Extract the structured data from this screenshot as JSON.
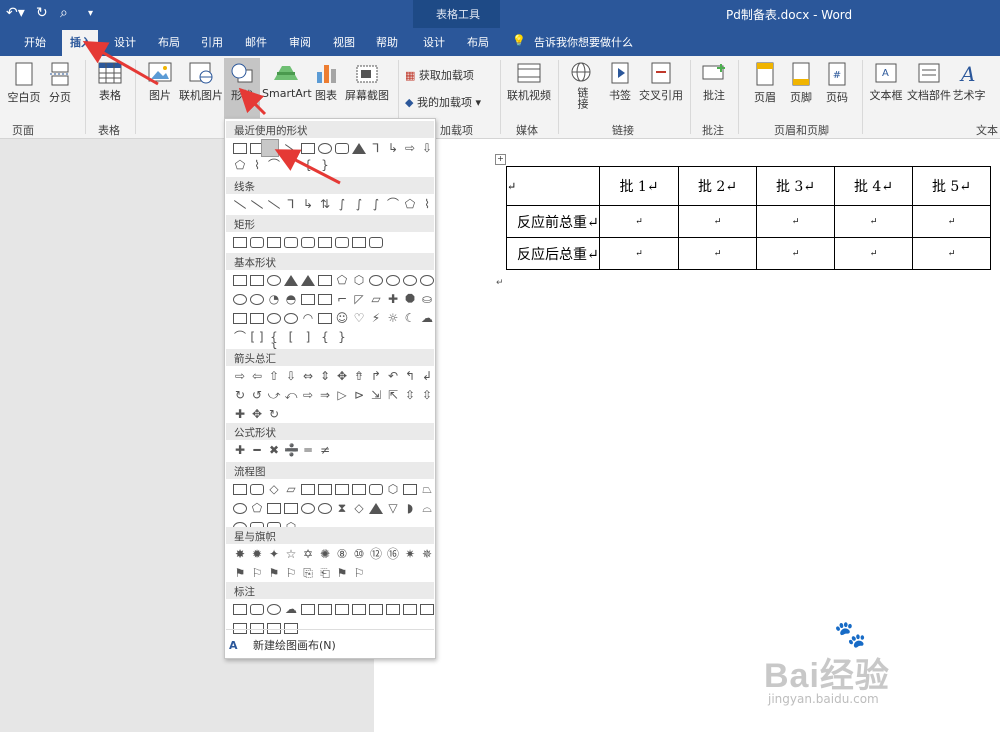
{
  "window": {
    "title": "Pd制备表.docx  -  Word",
    "context_group": "表格工具"
  },
  "quick_access": {
    "undo_icon": "undo-icon",
    "redo_icon": "redo-icon",
    "preview_icon": "print-preview-icon",
    "customize_icon": "customize-qat-icon"
  },
  "tabs": [
    {
      "label": "开始"
    },
    {
      "label": "插入",
      "active": true
    },
    {
      "label": "设计"
    },
    {
      "label": "布局"
    },
    {
      "label": "引用"
    },
    {
      "label": "邮件"
    },
    {
      "label": "审阅"
    },
    {
      "label": "视图"
    },
    {
      "label": "帮助"
    },
    {
      "label": "设计"
    },
    {
      "label": "布局"
    }
  ],
  "tell_me": "告诉我你想要做什么",
  "ribbon": {
    "blank_page": "空白页",
    "page_break": "分页",
    "table": "表格",
    "picture": "图片",
    "online_picture": "联机图片",
    "shapes": "形状",
    "smartart": "SmartArt",
    "chart": "图表",
    "screenshot": "屏幕截图",
    "get_addins": "获取加载项",
    "my_addins": "我的加载项",
    "online_video": "联机视频",
    "link": "链接",
    "bookmark": "书签",
    "cross_ref": "交叉引用",
    "comment": "批注",
    "header": "页眉",
    "footer": "页脚",
    "page_number": "页码",
    "textbox": "文本框",
    "quick_parts": "文档部件",
    "wordart": "艺术字",
    "groups": {
      "pages": "页面",
      "tables": "表格",
      "addins": "加载项",
      "media": "媒体",
      "links": "链接",
      "comments": "批注",
      "header_footer": "页眉和页脚",
      "text": "文本"
    }
  },
  "shapes_menu": {
    "categories": [
      "最近使用的形状",
      "线条",
      "矩形",
      "基本形状",
      "箭头总汇",
      "公式形状",
      "流程图",
      "星与旗帜",
      "标注"
    ],
    "new_canvas": "新建绘图画布(N)"
  },
  "doc_table": {
    "header": [
      "↵",
      "批 1↵",
      "批 2↵",
      "批 3↵",
      "批 4↵",
      "批 5↵"
    ],
    "rows": [
      [
        "反应前总重↵",
        "↵",
        "↵",
        "↵",
        "↵",
        "↵"
      ],
      [
        "反应后总重↵",
        "↵",
        "↵",
        "↵",
        "↵",
        "↵"
      ]
    ],
    "after_mark": "↵"
  },
  "watermark": {
    "brand": "Bai经验",
    "url": "jingyan.baidu.com"
  },
  "colors": {
    "title_bg": "#2b579a",
    "annotation_red": "#e53935"
  }
}
